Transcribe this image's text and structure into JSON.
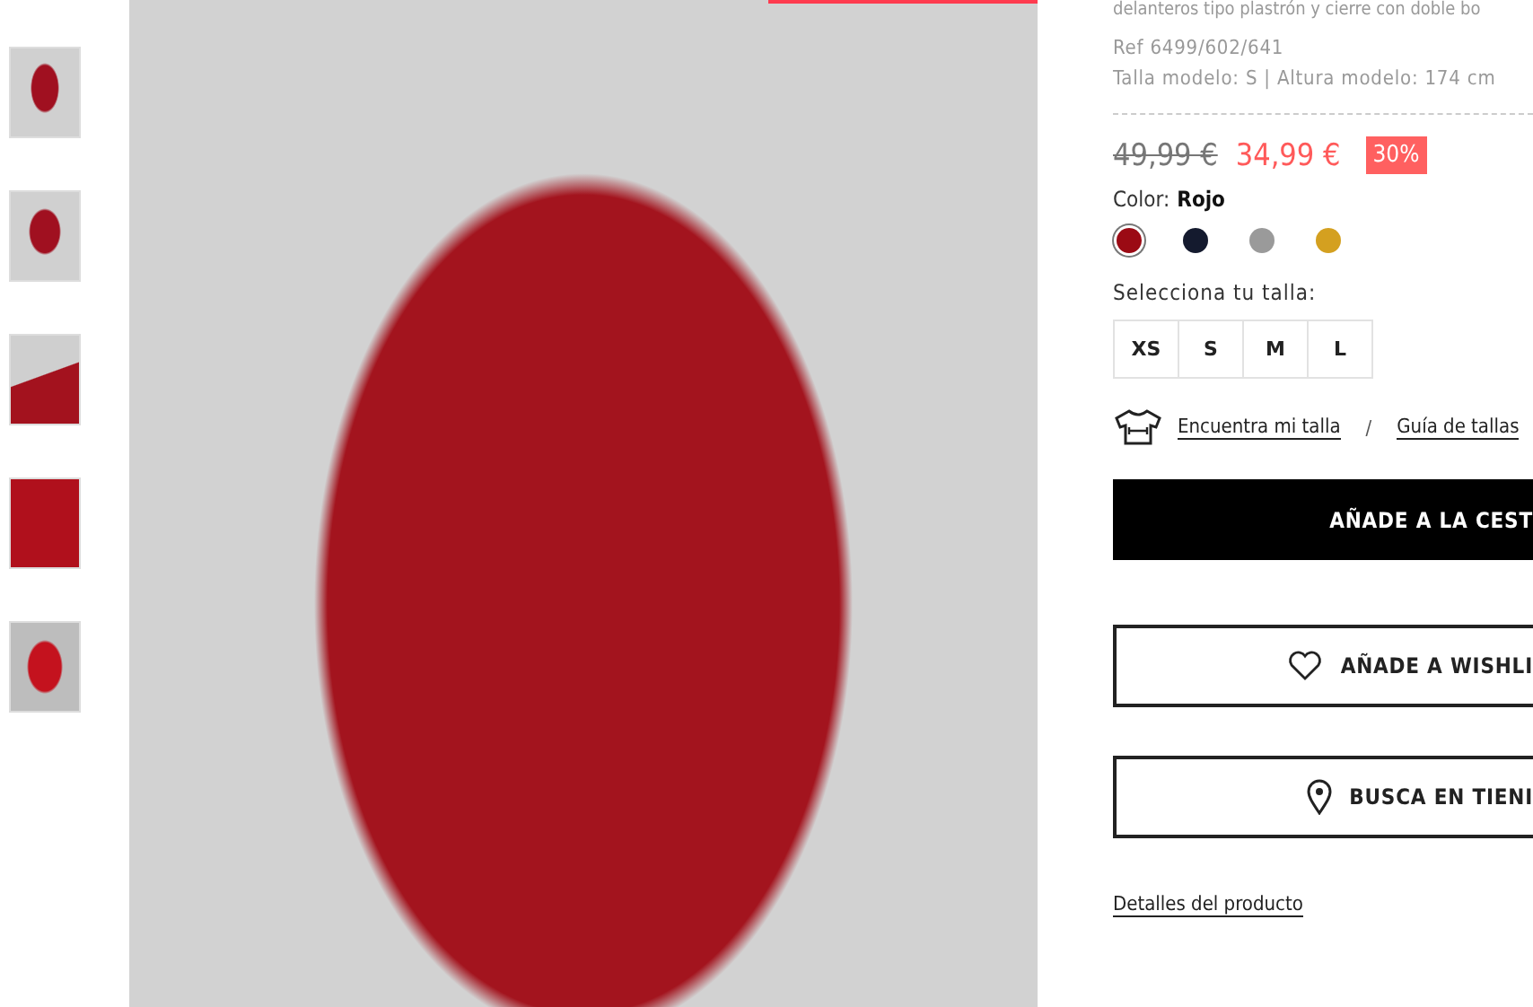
{
  "thumbnails": [
    {
      "selected": false
    },
    {
      "selected": false
    },
    {
      "selected": false
    },
    {
      "selected": false
    },
    {
      "selected": false
    }
  ],
  "product": {
    "description_tail": "delanteros tipo plastrón y cierre con doble bo",
    "ref": "Ref 6499/602/641",
    "model_info": "Talla modelo: S | Altura modelo: 174 cm",
    "old_price": "49,99 €",
    "price": "34,99 €",
    "discount": "30%",
    "color_label": "Color:",
    "color_name": "Rojo",
    "colors": [
      {
        "color": "#9b0a14",
        "selected": true
      },
      {
        "color": "#141a2e",
        "selected": false
      },
      {
        "color": "#9a9a9a",
        "selected": false
      },
      {
        "color": "#d4a020",
        "selected": false
      }
    ],
    "size_label": "Selecciona tu talla:",
    "sizes": [
      {
        "label": "XS",
        "selected": false
      },
      {
        "label": "S",
        "selected": false
      },
      {
        "label": "M",
        "selected": false
      },
      {
        "label": "L",
        "selected": false
      }
    ],
    "find_size_link": "Encuentra mi talla",
    "separator": "/",
    "size_guide_link": "Guía de tallas",
    "buttons": [
      {
        "kind": "primary",
        "label": "AÑADE A LA CEST"
      },
      {
        "kind": "wishlist",
        "label": "AÑADE A WISHLI"
      },
      {
        "kind": "store",
        "label": "BUSCA EN TIENI"
      }
    ],
    "details_link": "Detalles del producto"
  }
}
